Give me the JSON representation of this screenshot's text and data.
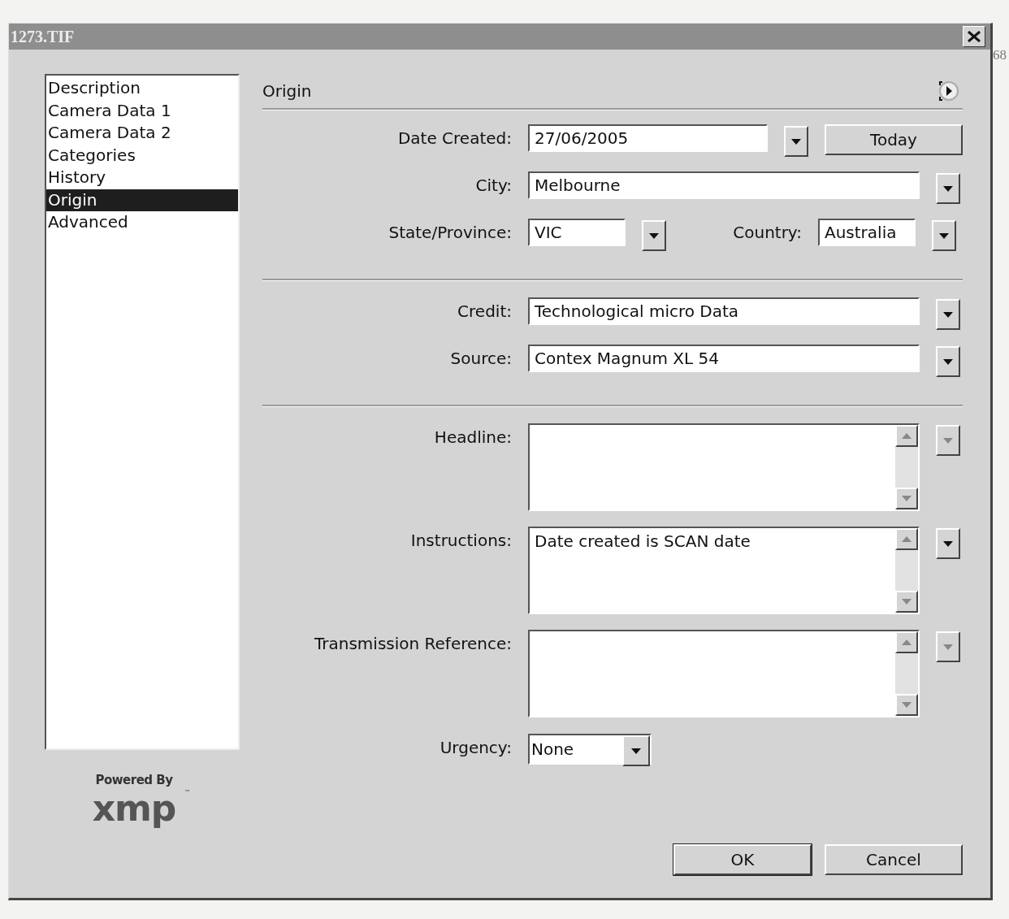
{
  "window": {
    "title": "1273.TIF"
  },
  "background": {
    "label": "68"
  },
  "sidebar": {
    "items": [
      {
        "label": "Description",
        "selected": false
      },
      {
        "label": "Camera Data 1",
        "selected": false
      },
      {
        "label": "Camera Data 2",
        "selected": false
      },
      {
        "label": "Categories",
        "selected": false
      },
      {
        "label": "History",
        "selected": false
      },
      {
        "label": "Origin",
        "selected": true
      },
      {
        "label": "Advanced",
        "selected": false
      }
    ]
  },
  "branding": {
    "powered_by": "Powered By",
    "logo": "xmp",
    "trademark": "™"
  },
  "panel": {
    "title": "Origin"
  },
  "date_created": {
    "label": "Date Created:",
    "value": "27/06/2005",
    "button": "Today"
  },
  "city": {
    "label": "City:",
    "value": "Melbourne"
  },
  "state": {
    "label": "State/Province:",
    "value": "VIC"
  },
  "country": {
    "label": "Country:",
    "value": "Australia"
  },
  "credit": {
    "label": "Credit:",
    "value": "Technological micro Data"
  },
  "source": {
    "label": "Source:",
    "value": "Contex Magnum XL 54"
  },
  "text_areas": [
    {
      "label": "Headline:",
      "history_enabled": false
    },
    {
      "label": "Instructions:",
      "value": "Date created is SCAN date",
      "history_enabled": true
    },
    {
      "label": "Transmission Reference:",
      "history_enabled": false
    }
  ],
  "urgency": {
    "label": "Urgency:",
    "value": "None"
  },
  "buttons": [
    {
      "label": "OK",
      "default": true
    },
    {
      "label": "Cancel",
      "default": false
    }
  ]
}
